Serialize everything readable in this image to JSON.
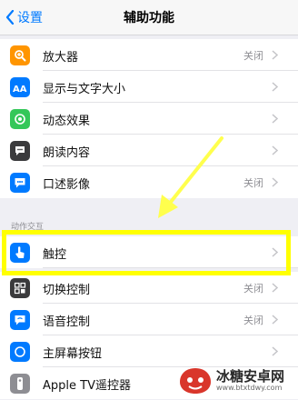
{
  "nav": {
    "back_label": "设置",
    "title": "辅助功能"
  },
  "section_header": "动作交互",
  "rows": [
    {
      "label": "放大器",
      "value": "关闭",
      "icon": "magnifier-icon",
      "color": "#ff9500"
    },
    {
      "label": "显示与文字大小",
      "value": "",
      "icon": "text-size-icon",
      "color": "#007aff"
    },
    {
      "label": "动态效果",
      "value": "",
      "icon": "motion-icon",
      "color": "#34c759"
    },
    {
      "label": "朗读内容",
      "value": "",
      "icon": "speech-icon",
      "color": "#3a3a3c"
    },
    {
      "label": "口述影像",
      "value": "关闭",
      "icon": "audio-description-icon",
      "color": "#007aff"
    },
    {
      "label": "触控",
      "value": "",
      "icon": "touch-hand-icon",
      "color": "#007aff"
    },
    {
      "label": "切换控制",
      "value": "关闭",
      "icon": "switch-control-icon",
      "color": "#3a3a3c"
    },
    {
      "label": "语音控制",
      "value": "关闭",
      "icon": "voice-control-icon",
      "color": "#007aff"
    },
    {
      "label": "主屏幕按钮",
      "value": "",
      "icon": "home-button-icon",
      "color": "#007aff"
    },
    {
      "label": "Apple TV遥控器",
      "value": "",
      "icon": "remote-icon",
      "color": "#8e8e93"
    }
  ],
  "watermark": {
    "title": "冰糖安卓网",
    "url": "www.btxtdwy.com"
  },
  "colors": {
    "accent": "#007aff",
    "highlight": "#ffff00",
    "arrow": "#ffff4d"
  }
}
